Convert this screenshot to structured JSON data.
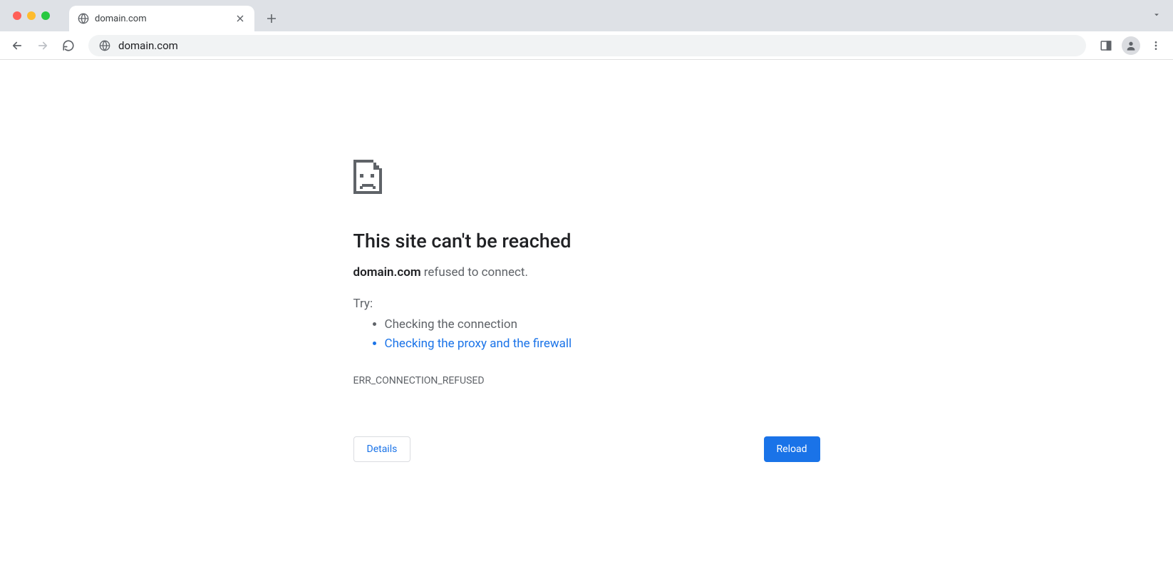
{
  "tab": {
    "title": "domain.com"
  },
  "omnibox": {
    "url": "domain.com"
  },
  "error": {
    "title": "This site can't be reached",
    "host": "domain.com",
    "desc_suffix": " refused to connect.",
    "try_label": "Try:",
    "suggestions": {
      "check_connection": "Checking the connection",
      "check_proxy": "Checking the proxy and the firewall"
    },
    "code": "ERR_CONNECTION_REFUSED",
    "details_label": "Details",
    "reload_label": "Reload"
  }
}
